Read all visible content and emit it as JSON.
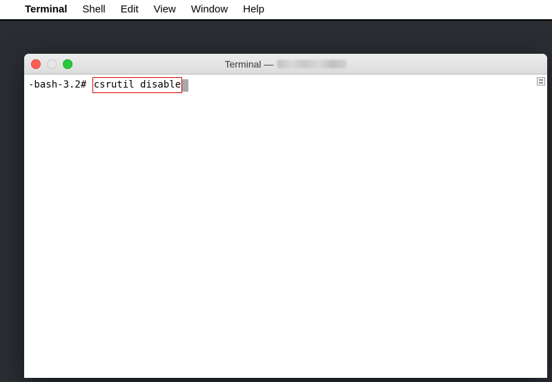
{
  "menubar": {
    "app_name": "Terminal",
    "items": [
      "Shell",
      "Edit",
      "View",
      "Window",
      "Help"
    ]
  },
  "window": {
    "title_prefix": "Terminal —"
  },
  "terminal": {
    "prompt": "-bash-3.2# ",
    "command": "csrutil disable"
  }
}
